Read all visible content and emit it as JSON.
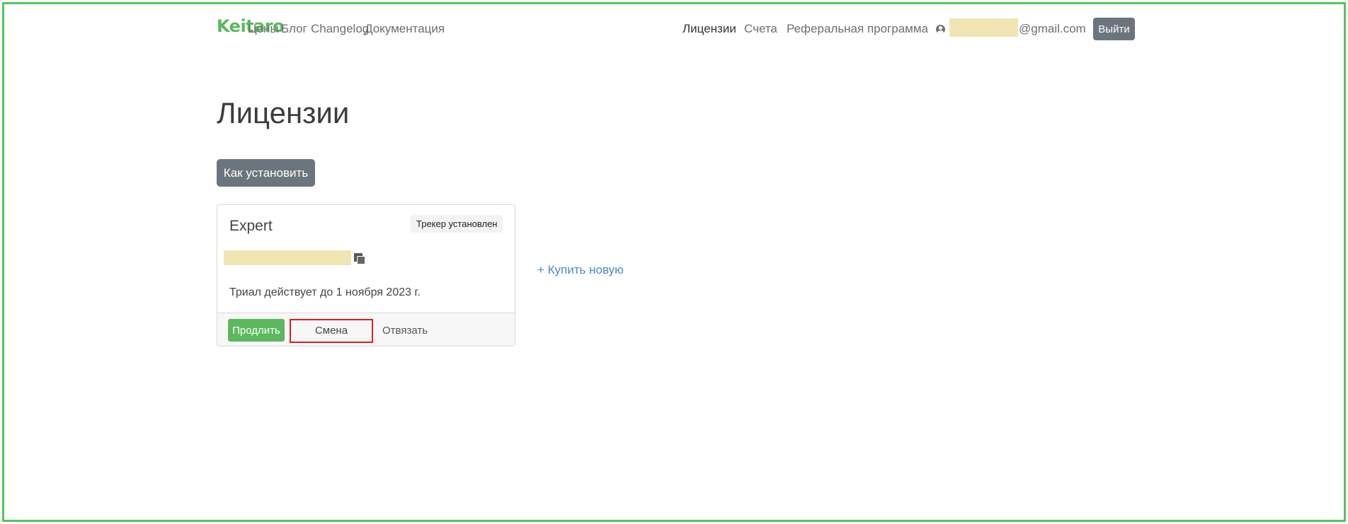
{
  "nav": {
    "logo": "Keitaro",
    "left_links": [
      "Цены",
      "Блог",
      "Changelog",
      "Документация"
    ],
    "right_links": [
      "Лицензии",
      "Счета",
      "Реферальная программа"
    ],
    "active_link": "Лицензии",
    "email_domain": "@gmail.com",
    "logout_label": "Выйти"
  },
  "page": {
    "title": "Лицензии",
    "how_to_install_label": "Как установить",
    "buy_new_label": "+ Купить новую"
  },
  "license_card": {
    "name": "Expert",
    "badge": "Трекер установлен",
    "trial_text": "Триал действует до 1 ноября 2023 г.",
    "actions": {
      "extend": "Продлить",
      "change_edition": "Смена редакции",
      "unlink": "Отвязать"
    }
  },
  "colors": {
    "brand_green": "#5cb85c",
    "frame_green": "#5cc25c",
    "button_gray": "#6c757d",
    "highlight_red": "#e01e1e",
    "link_blue": "#4a8bc9"
  }
}
